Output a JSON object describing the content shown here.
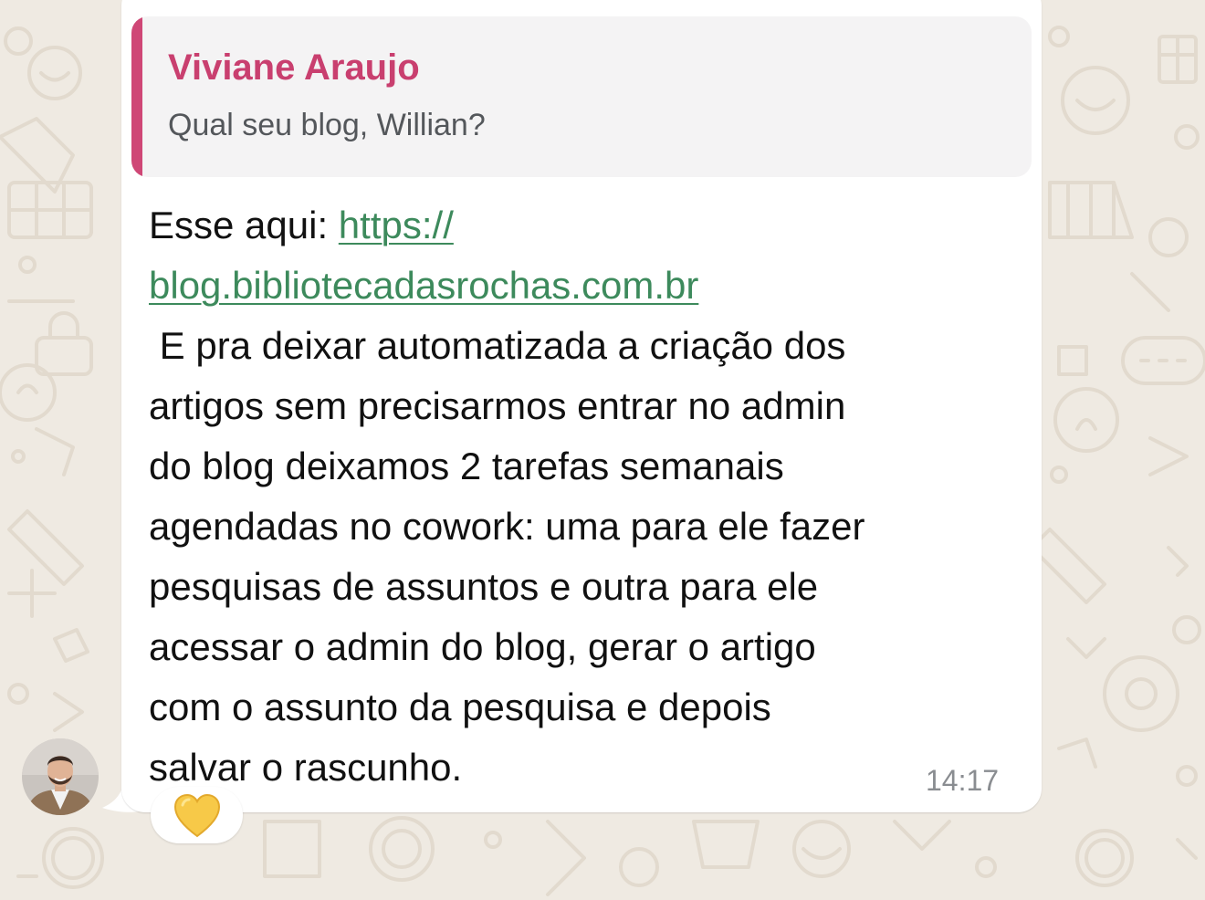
{
  "colors": {
    "background": "#efeae2",
    "bubble": "#ffffff",
    "quote_accent": "#cf4776",
    "link": "#3d8a5c",
    "timestamp": "#8a8d91",
    "reaction_heart": "#f7c948"
  },
  "quoted_message": {
    "author": "Viviane Araujo",
    "text": "Qual seu blog, Willian?"
  },
  "message": {
    "lines": [
      {
        "prefix": "Esse aqui: ",
        "link": "https://"
      },
      {
        "prefix": "",
        "link": "blog.bibliotecadasrochas.com.br"
      },
      {
        "text": " E pra deixar automatizada a criação dos"
      },
      {
        "text": "artigos sem precisarmos entrar no admin"
      },
      {
        "text": "do blog deixamos 2 tarefas semanais"
      },
      {
        "text": "agendadas no cowork: uma para ele fazer"
      },
      {
        "text": "pesquisas de assuntos e outra para ele"
      },
      {
        "text": "acessar o admin do blog, gerar o artigo"
      },
      {
        "text": "com o assunto da pesquisa e depois"
      },
      {
        "text": "salvar o rascunho."
      }
    ],
    "time": "14:17"
  },
  "sender": {
    "avatar_icon": "person-avatar-icon"
  },
  "reaction": {
    "icon": "yellow-heart-icon"
  }
}
